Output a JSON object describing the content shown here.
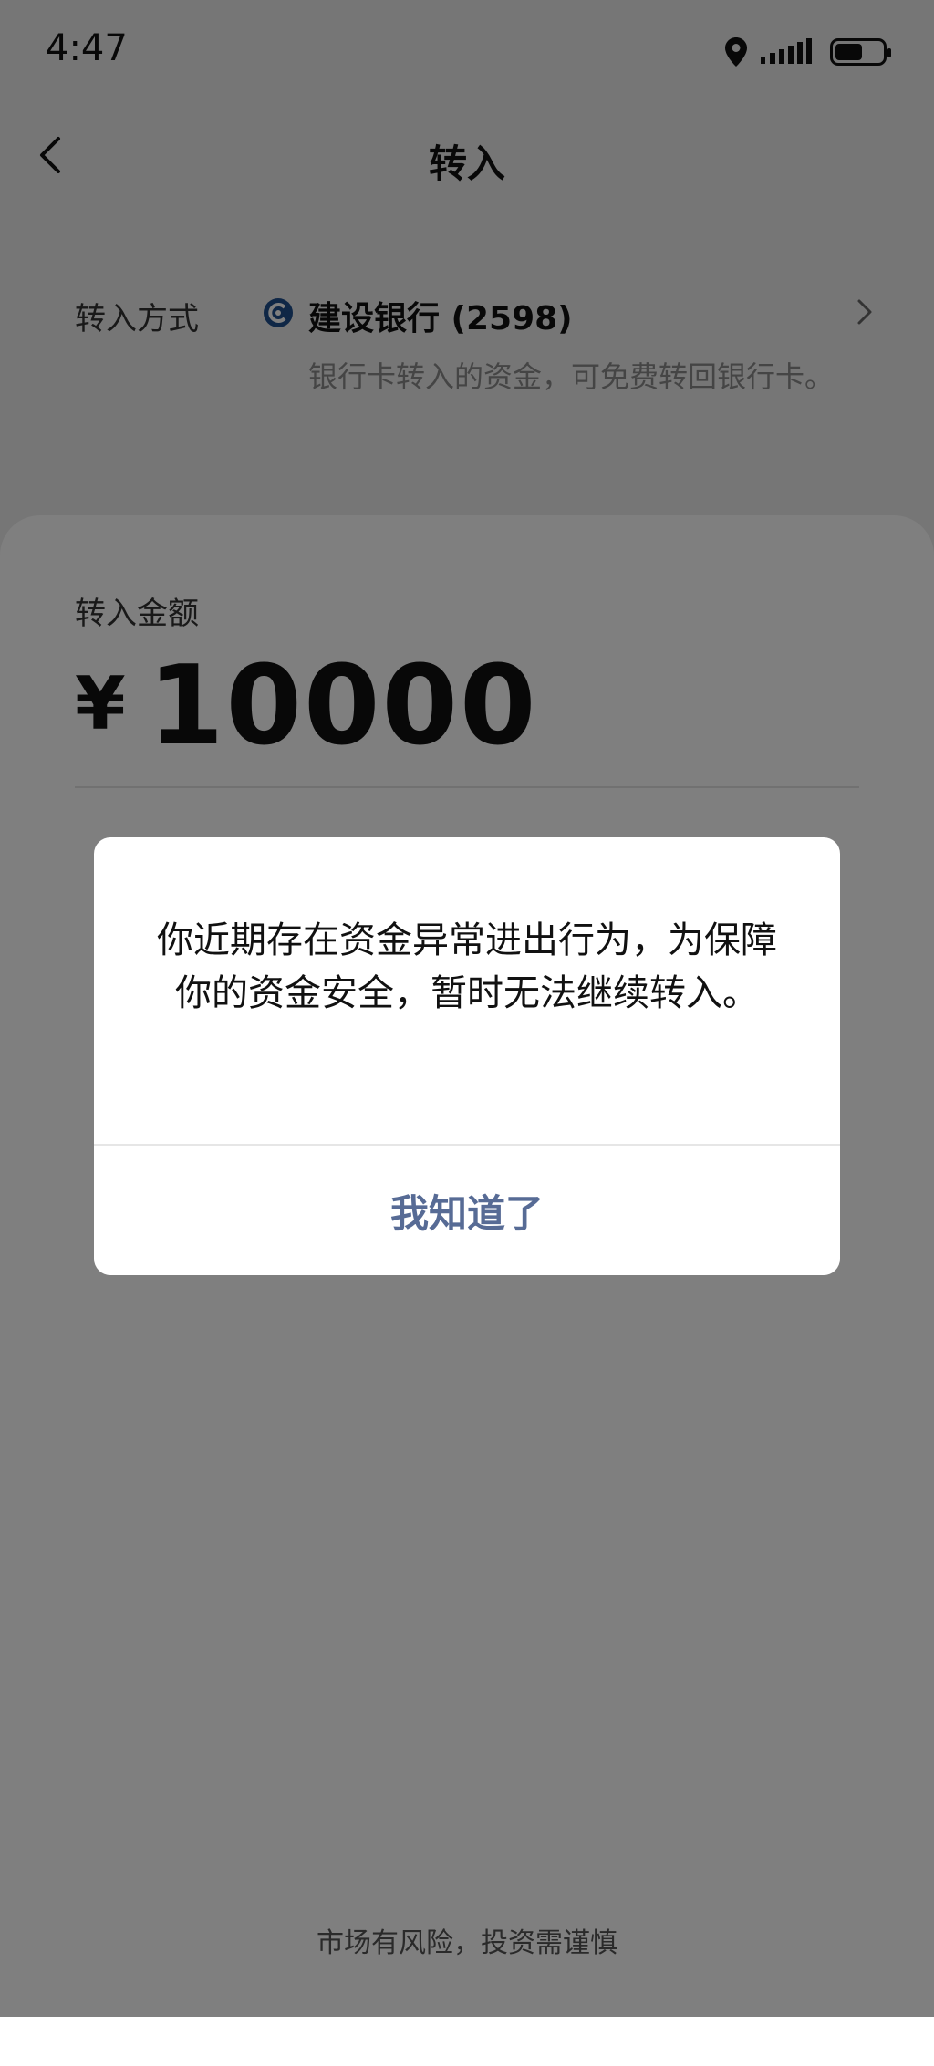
{
  "status_bar": {
    "time": "4:47",
    "icons": [
      "location-icon",
      "signal-icon",
      "battery-icon"
    ],
    "battery_level": 0.6
  },
  "nav": {
    "title": "转入",
    "back_icon": "chevron-left-icon"
  },
  "transfer_method": {
    "label": "转入方式",
    "bank_icon": "ccb-bank-logo-icon",
    "bank_name": "建设银行 (2598)",
    "note": "银行卡转入的资金，可免费转回银行卡。",
    "chevron_icon": "chevron-right-icon"
  },
  "amount": {
    "label": "转入金额",
    "currency": "¥",
    "value": "10000"
  },
  "footer": {
    "risk_note": "市场有风险，投资需谨慎"
  },
  "dialog": {
    "message": "你近期存在资金异常进出行为，为保障你的资金安全，暂时无法继续转入。",
    "button_label": "我知道了"
  },
  "colors": {
    "dialog_button": "#576b95",
    "overlay": "rgba(0,0,0,0.5)",
    "bank_logo": "#1f4e8c"
  }
}
